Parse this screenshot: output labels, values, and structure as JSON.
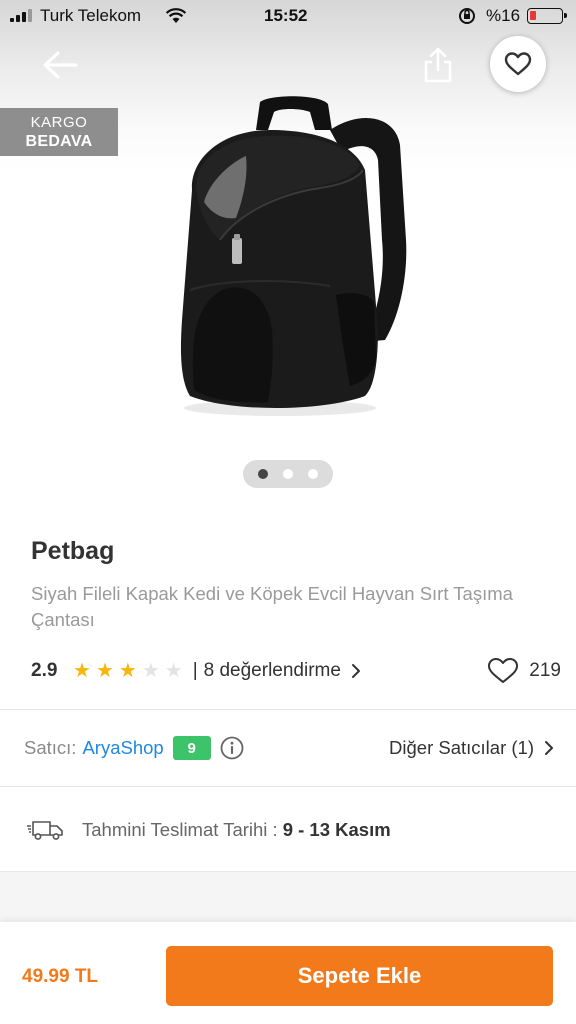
{
  "status_bar": {
    "carrier": "Turk Telekom",
    "time": "15:52",
    "battery_percent": "%16",
    "battery_level": 0.16,
    "icons": [
      "signal-icon",
      "wifi-icon",
      "rotation-lock-icon",
      "battery-icon"
    ]
  },
  "header": {
    "icons": [
      "back-arrow-icon",
      "share-icon",
      "heart-icon"
    ]
  },
  "badge": {
    "line1": "KARGO",
    "line2": "BEDAVA"
  },
  "gallery": {
    "image_count": 3,
    "active_index": 0
  },
  "product": {
    "brand": "Petbag",
    "title": "Siyah Fileli Kapak Kedi ve Köpek Evcil Hayvan Sırt Taşıma Çantası",
    "rating": "2.9",
    "stars_filled": 3,
    "stars_total": 5,
    "reviews_sep": "|",
    "reviews_text": "8 değerlendirme",
    "favorite_count": "219"
  },
  "seller": {
    "label": "Satıcı:",
    "name": "AryaShop",
    "score": "9",
    "other_sellers": "Diğer Satıcılar (1)"
  },
  "delivery": {
    "label": "Tahmini Teslimat Tarihi :",
    "date": "9 - 13 Kasım"
  },
  "footer": {
    "price": "49.99 TL",
    "add_to_cart": "Sepete Ekle"
  },
  "colors": {
    "accent": "#f27a1a",
    "seller_link": "#1e88e5",
    "seller_score": "#3dc46b",
    "star": "#f6b60b",
    "badge_bg": "#8e8e8e"
  }
}
